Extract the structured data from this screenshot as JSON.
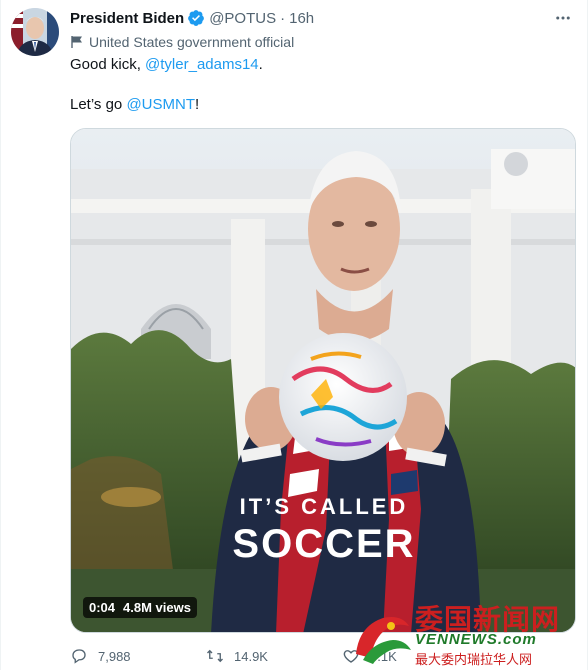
{
  "tweet": {
    "author_name": "President Biden",
    "handle": "@POTUS",
    "separator": "·",
    "time": "16h",
    "affiliation": "United States government official",
    "line1_text": "Good kick, ",
    "line1_mention": "@tyler_adams14",
    "line1_end": ".",
    "line2_text": "Let’s go ",
    "line2_mention": "@USMNT",
    "line2_end": "!"
  },
  "media": {
    "overlay_line1": "IT’S CALLED",
    "overlay_line2": "SOCCER",
    "duration": "0:04",
    "views": "4.8M views"
  },
  "actions": {
    "replies": "7,988",
    "retweets": "14.9K",
    "likes": "6.1K"
  },
  "watermark": {
    "title": "委国新闻网",
    "url": "VENNEWS.com",
    "subtitle": "最大委内瑞拉华人网"
  },
  "colors": {
    "accent": "#1d9bf0",
    "muted": "#536471",
    "text": "#0f1419"
  },
  "icons": {
    "verified": "verified-badge-icon",
    "more": "more-dots-icon",
    "affiliation": "flag-icon",
    "reply": "reply-icon",
    "retweet": "retweet-icon",
    "like": "like-icon"
  }
}
